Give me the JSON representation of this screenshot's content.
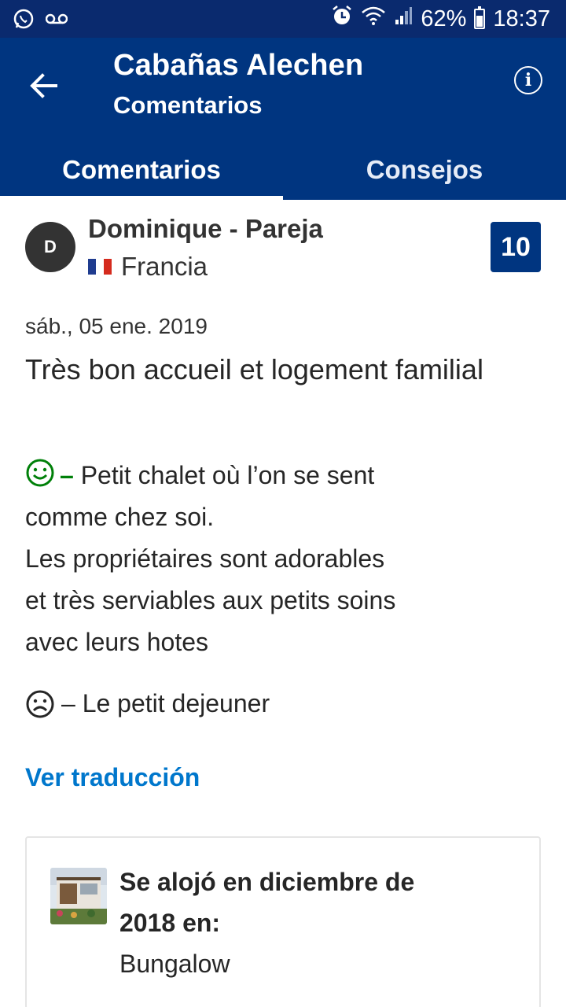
{
  "status_bar": {
    "battery": "62%",
    "time": "18:37",
    "icons": [
      "whatsapp-icon",
      "voicemail-icon",
      "alarm-icon",
      "wifi-icon",
      "signal-icon",
      "battery-icon"
    ]
  },
  "header": {
    "title": "Cabañas Alechen",
    "subtitle": "Comentarios",
    "back_icon": "back-arrow-icon",
    "info_icon": "info-icon",
    "info_glyph": "i"
  },
  "tabs": [
    {
      "label": "Comentarios",
      "active": true
    },
    {
      "label": "Consejos",
      "active": false
    }
  ],
  "review": {
    "avatar_initial": "D",
    "reviewer": "Dominique - Pareja",
    "country": "Francia",
    "score": "10",
    "date": "sáb., 05 ene. 2019",
    "title": "Très bon accueil et logement familial",
    "positive_dash": "–",
    "positive_lines": [
      "Petit chalet où l’on se sent",
      "comme chez soi.",
      "Les propriétaires sont adorables",
      "et très serviables aux petits soins",
      "avec leurs hotes"
    ],
    "negative_text": "– Le petit dejeuner",
    "translate_link": "Ver traducción"
  },
  "stay": {
    "text_line1": "Se alojó en diciembre de",
    "text_line2": "2018 en:",
    "room": "Bungalow"
  },
  "colors": {
    "brand_blue": "#003580",
    "status_bar": "#0a2a6e",
    "positive_green": "#008009",
    "link_blue": "#0077cc"
  }
}
